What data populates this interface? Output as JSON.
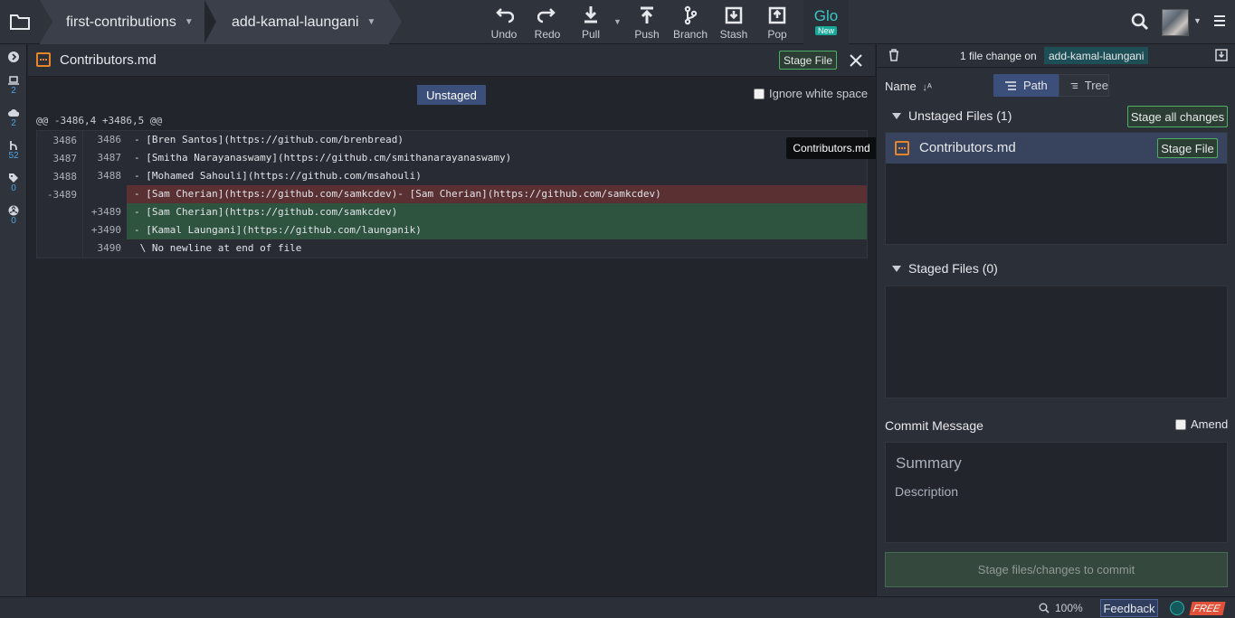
{
  "toolbar": {
    "repo": "first-contributions",
    "branch": "add-kamal-laungani",
    "actions": {
      "undo": "Undo",
      "redo": "Redo",
      "pull": "Pull",
      "push": "Push",
      "branch": "Branch",
      "stash": "Stash",
      "pop": "Pop"
    },
    "glo": "Glo",
    "glo_badge": "New"
  },
  "rail": {
    "counts": [
      "2",
      "2",
      "52",
      "0",
      "0"
    ]
  },
  "diff": {
    "filename": "Contributors.md",
    "stage_file_label": "Stage File",
    "view_badge": "Unstaged",
    "ignore_whitespace_label": "Ignore white space",
    "hunk_header": "@@ -3486,4 +3486,5 @@",
    "lines": [
      {
        "old": "3486",
        "new": "3486",
        "type": "context",
        "text": "- [Bren Santos](https://github.com/brenbread)"
      },
      {
        "old": "3487",
        "new": "3487",
        "type": "context",
        "text": "- [Smitha Narayanaswamy](https://github.cm/smithanarayanaswamy)"
      },
      {
        "old": "3488",
        "new": "3488",
        "type": "context",
        "text": "- [Mohamed Sahouli](https://github.com/msahouli)"
      },
      {
        "old": "-3489",
        "new": "",
        "type": "del",
        "text": "- [Sam Cherian](https://github.com/samkcdev)- [Sam Cherian](https://github.com/samkcdev)"
      },
      {
        "old": "",
        "new": "+3489",
        "type": "add",
        "text": "- [Sam Cherian](https://github.com/samkcdev)"
      },
      {
        "old": "",
        "new": "+3490",
        "type": "add",
        "text": "- [Kamal Laungani](https://github.com/launganik)"
      },
      {
        "old": "",
        "new": "3490",
        "type": "context",
        "text": " \\ No newline at end of file"
      }
    ]
  },
  "tooltip": "Contributors.md",
  "right_panel": {
    "summary": "1 file change on",
    "branch": "add-kamal-laungani",
    "sort_label": "Name",
    "view_path": "Path",
    "view_tree": "Tree",
    "unstaged_title": "Unstaged Files (1)",
    "stage_all_label": "Stage all changes",
    "unstaged_files": [
      {
        "name": "Contributors.md",
        "action": "Stage File"
      }
    ],
    "staged_title": "Staged Files (0)",
    "commit_message_label": "Commit Message",
    "amend_label": "Amend",
    "summary_placeholder": "Summary",
    "description_placeholder": "Description",
    "commit_button": "Stage files/changes to commit"
  },
  "status_bar": {
    "zoom": "100%",
    "feedback": "Feedback",
    "plan_badge": "FREE"
  },
  "colors": {
    "accent_blue": "#3c4f7a",
    "stage_green": "#4caf65",
    "file_orange": "#e6842a",
    "glo_teal": "#3cc6c4",
    "free_red": "#e0513a"
  }
}
